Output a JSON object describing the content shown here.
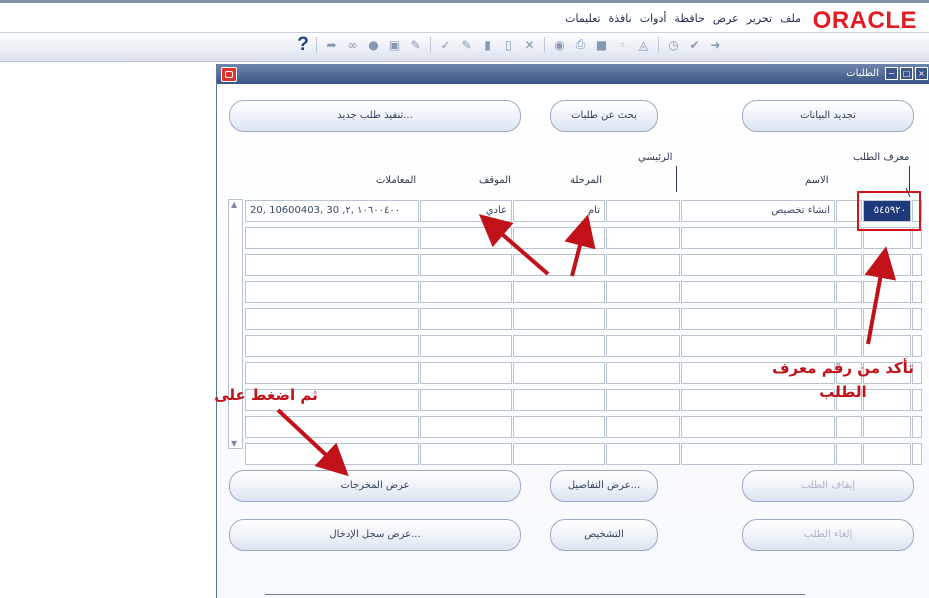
{
  "app": {
    "logo": "ORACLE",
    "menu": [
      "ملف",
      "تحرير",
      "عرض",
      "حافظة",
      "أدوات",
      "نافذة",
      "تعليمات"
    ]
  },
  "toolbar": {
    "help": "?",
    "icons": [
      "forward-icon",
      "save-icon",
      "open-icon",
      "print-icon",
      "find-icon",
      "zoom-icon",
      "cut-icon",
      "copy-icon",
      "paste-icon",
      "clear-icon",
      "spell-icon",
      "attach-icon",
      "globe-icon",
      "folder-icon",
      "pen-icon",
      "translate-icon",
      "note-icon"
    ]
  },
  "window": {
    "title": "الطلبات",
    "buttons": {
      "refresh": "تجديد البيانات",
      "find": "بحث عن طلبات",
      "submit_new": "تنفيذ طلب جديد...",
      "hold": "إيقاف الطلب",
      "details": "عرض التفاصيل...",
      "view_output": "عرض المخرجات",
      "cancel": "إلغاء الطلب",
      "diagnostics": "التشخيص",
      "view_log": "عرض سجل الإدخال..."
    },
    "columns": {
      "request_id": "معرف الطلب",
      "name": "الاسم",
      "parent": "الرئيسي",
      "phase": "المرحلة",
      "status": "الموقف",
      "parameters": "المعاملات"
    },
    "rows": [
      {
        "request_id": "٥٤٥٩٢٠",
        "name": "انشاء تخصيص",
        "parent": "",
        "phase": "تام",
        "status": "عادي",
        "parameters": "20, 10600403, 30 ,١٠٦٠٠٤٠٠ ,٢"
      }
    ],
    "empty_rows": 9
  },
  "annotations": {
    "verify": "تأكد من رقم معرف\nالطلب",
    "then_click": "ثم اضغط على"
  },
  "colors": {
    "oracle_red": "#e51b24",
    "title_blue": "#3a5586",
    "selected_cell": "#1e3a7b",
    "annotation_red": "#c1121a"
  }
}
